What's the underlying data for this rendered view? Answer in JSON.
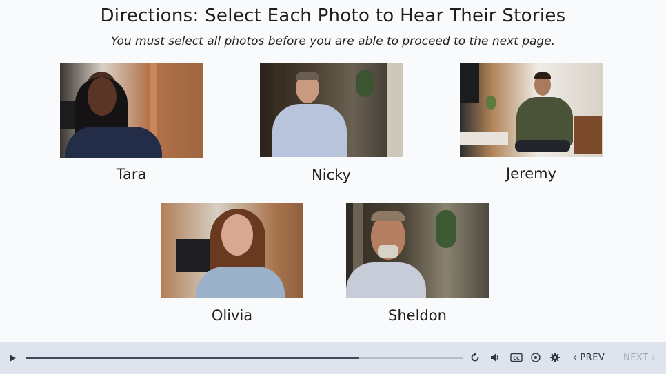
{
  "slide": {
    "title": "Directions: Select Each Photo to Hear Their Stories",
    "subtitle": "You must select all photos before you are able to proceed to the next page."
  },
  "photos": [
    {
      "name": "Tara"
    },
    {
      "name": "Nicky"
    },
    {
      "name": "Jeremy"
    },
    {
      "name": "Olivia"
    },
    {
      "name": "Sheldon"
    }
  ],
  "player": {
    "progress_fraction": 0.76,
    "prev_label": "PREV",
    "next_label": "NEXT",
    "cc_label": "CC",
    "icons": [
      "play-icon",
      "replay-icon",
      "volume-icon",
      "captions-icon",
      "accessibility-icon",
      "settings-icon",
      "chevron-left-icon",
      "chevron-right-icon"
    ]
  }
}
